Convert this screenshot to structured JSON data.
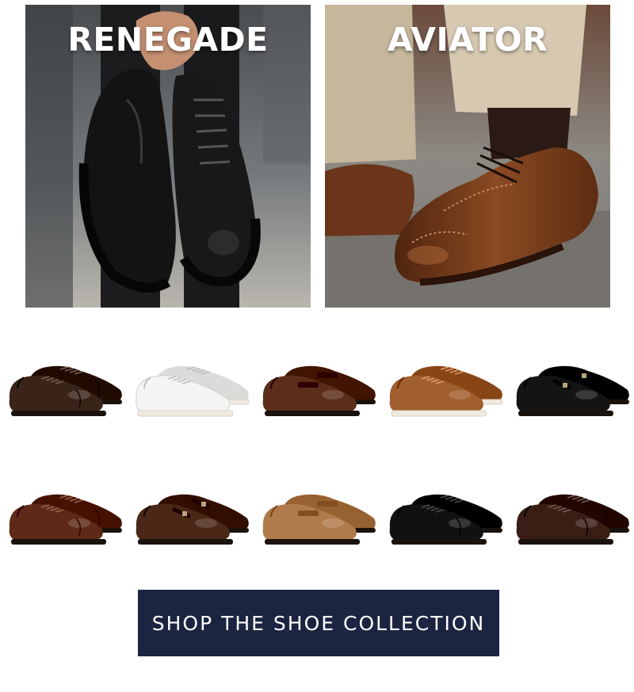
{
  "heroes": [
    {
      "title": "RENEGADE",
      "colors": {
        "background": "#6f7377",
        "shoe": "#141414"
      }
    },
    {
      "title": "AVIATOR",
      "colors": {
        "background": "#8a8680",
        "shoe": "#7a3e1c"
      }
    }
  ],
  "shoes": [
    {
      "name": "dark-brown-oxford",
      "style": "oxford",
      "color": "#3a2418"
    },
    {
      "name": "white-sneaker",
      "style": "sneaker",
      "color": "#f4f4f2"
    },
    {
      "name": "brown-penny-loafer",
      "style": "loafer",
      "color": "#5a2e1a"
    },
    {
      "name": "tan-sneaker",
      "style": "sneaker",
      "color": "#a15e2e"
    },
    {
      "name": "black-monk-strap",
      "style": "monk",
      "color": "#141414"
    },
    {
      "name": "brown-oxford",
      "style": "oxford",
      "color": "#5e2a17"
    },
    {
      "name": "brown-double-monk",
      "style": "monk",
      "color": "#4a2716"
    },
    {
      "name": "tan-suede-loafer",
      "style": "loafer",
      "color": "#b07a4a"
    },
    {
      "name": "black-oxford",
      "style": "oxford",
      "color": "#111111"
    },
    {
      "name": "espresso-oxford",
      "style": "oxford",
      "color": "#3a1e16"
    }
  ],
  "cta": {
    "label": "SHOP THE SHOE COLLECTION",
    "color": "#1b2440"
  }
}
